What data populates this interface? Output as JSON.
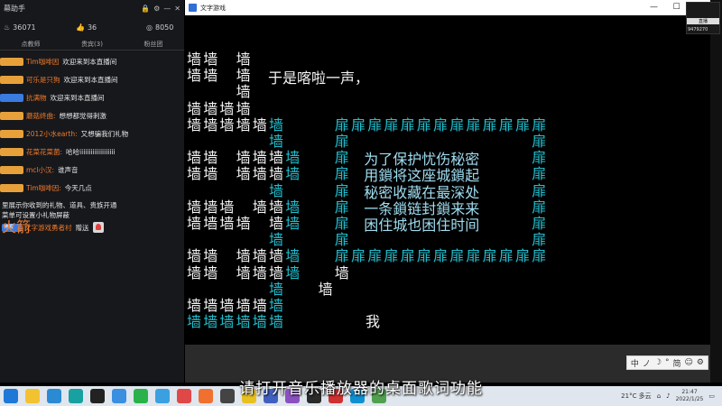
{
  "left_panel": {
    "title": "幕助手",
    "stats": {
      "followers": "36071",
      "likes": "36",
      "coins": "8050"
    },
    "tabs": [
      "点教师",
      "贵宾(3)",
      "粉丝团"
    ],
    "chat": [
      {
        "badge": "",
        "user": "Tim咖啡因",
        "msg": "欢迎来到本直播间",
        "blue": false
      },
      {
        "badge": "",
        "user": "可乐是只狗",
        "msg": "欢迎来到本直播间",
        "blue": false
      },
      {
        "badge": "",
        "user": "抗满物",
        "msg": "欢迎来到本直播间",
        "blue": true
      },
      {
        "badge": "",
        "user": "蘑菇终曲:",
        "msg": "想想都觉得刺激",
        "blue": false
      },
      {
        "badge": "",
        "user": "2012小水earth:",
        "msg": "又想骗我们礼物",
        "blue": false
      },
      {
        "badge": "",
        "user": "花菜花菜菌:",
        "msg": "哈哈iiiiiiiiiiiiiiiiiii",
        "blue": false
      },
      {
        "badge": "",
        "user": "mcl小汉:",
        "msg": "谁声音",
        "blue": false
      },
      {
        "badge": "",
        "user": "Tim咖啡因:",
        "msg": "今天几点",
        "blue": false
      }
    ],
    "note_lines": [
      "里展示你收到的礼物、道具、贵族开通",
      "菜单可设置小礼物屏蔽"
    ],
    "gift": {
      "badge": "神殿",
      "user": "文字游戏勇者村",
      "verb": "赠送",
      "item": "火箭"
    }
  },
  "window": {
    "title": "文字游戏",
    "buttons": [
      "—",
      "☐",
      "✕"
    ]
  },
  "game": {
    "wall": "墙",
    "door": "扉",
    "narration": "于是喀啦一声，",
    "player": "我",
    "inscription": [
      "为了保护忧伤秘密",
      "用鎖将这座城鎖起",
      "秘密收藏在最深处",
      "一条鎖链封鎖来来",
      "困住城也困住时间"
    ]
  },
  "overlay": {
    "cam_label": "直播",
    "cam_num": "9479270"
  },
  "ime": {
    "items": [
      "中",
      "ノ",
      "☽",
      "°",
      "简",
      "☺",
      "⚙"
    ]
  },
  "subtitle": "请打开音乐播放器的桌面歌词功能",
  "taskbar": {
    "weather": "21°C 多云",
    "time": "21:47",
    "date": "2022/1/25"
  },
  "colors": {
    "accent_cyan": "#22c0d0",
    "chat_user": "#f07a2a",
    "panel_bg": "#17181c"
  }
}
